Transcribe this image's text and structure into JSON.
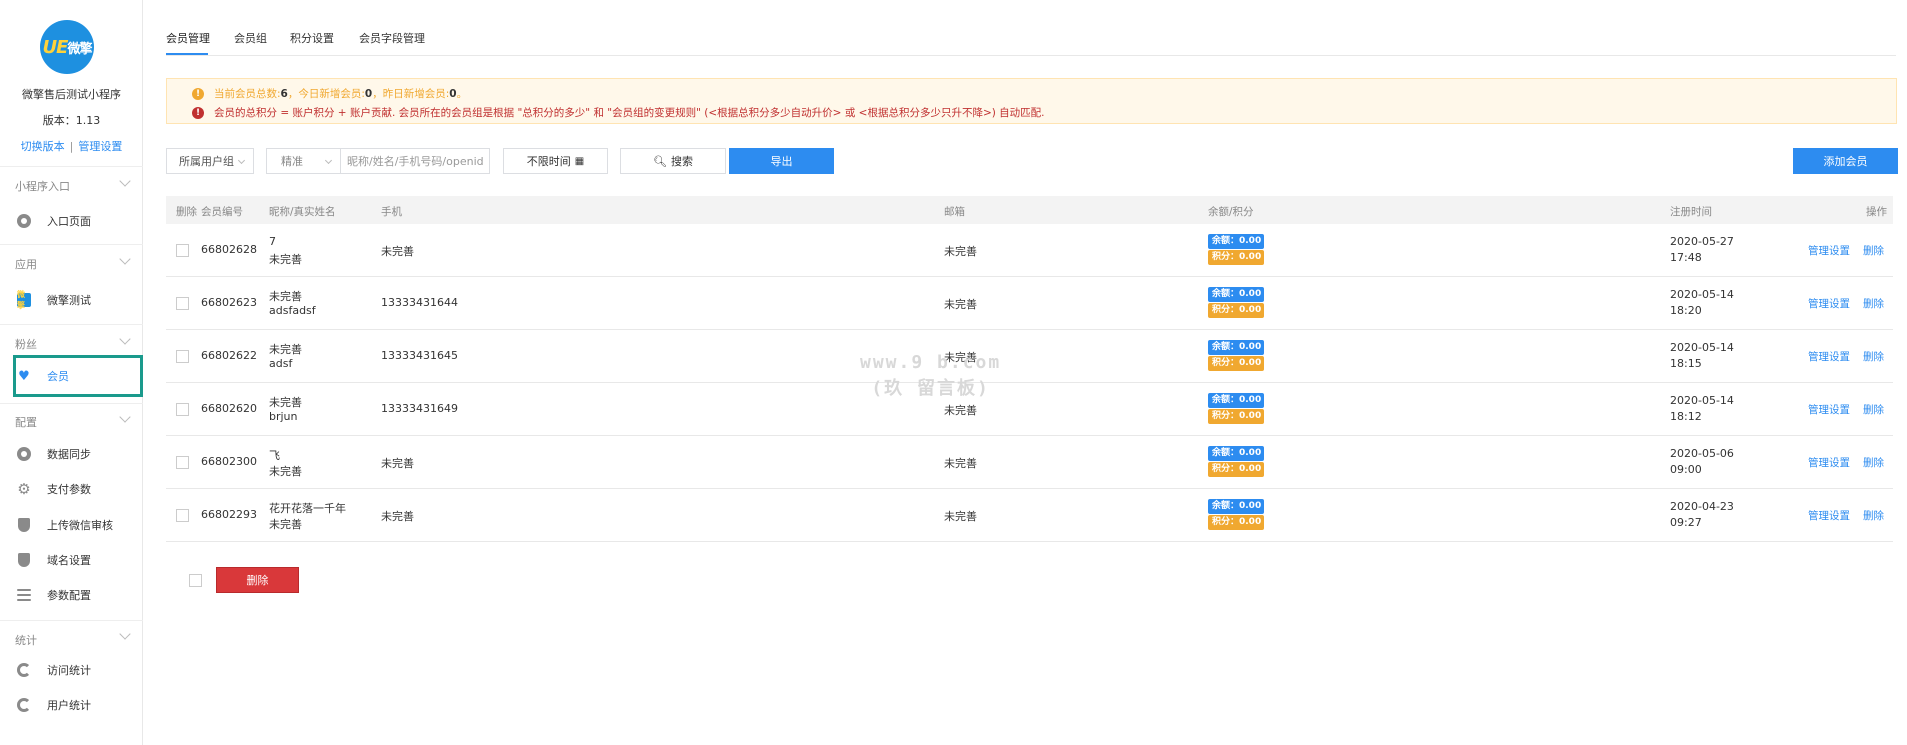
{
  "sidebar": {
    "logo_text_a": "UE",
    "logo_text_b": "微擎",
    "app_name": "微擎售后测试小程序",
    "version": "版本：1.13",
    "switch_version": "切换版本",
    "link_sep": "|",
    "manage_settings": "管理设置",
    "mini_logo": "微擎",
    "sections": [
      {
        "title": "小程序入口",
        "items": [
          {
            "label": "入口页面",
            "icon": "link-icon"
          }
        ]
      },
      {
        "title": "应用",
        "items": [
          {
            "label": "微擎测试",
            "icon": "app-logo-icon"
          }
        ]
      },
      {
        "title": "粉丝",
        "items": [
          {
            "label": "会员",
            "icon": "heart-icon"
          }
        ]
      },
      {
        "title": "配置",
        "items": [
          {
            "label": "数据同步",
            "icon": "link-icon"
          },
          {
            "label": "支付参数",
            "icon": "gear-icon"
          },
          {
            "label": "上传微信审核",
            "icon": "shield-icon"
          },
          {
            "label": "域名设置",
            "icon": "shield-icon"
          },
          {
            "label": "参数配置",
            "icon": "list-icon"
          }
        ]
      },
      {
        "title": "统计",
        "items": [
          {
            "label": "访问统计",
            "icon": "refresh-icon"
          },
          {
            "label": "用户统计",
            "icon": "refresh-icon"
          }
        ]
      }
    ]
  },
  "tabs": [
    "会员管理",
    "会员组",
    "积分设置",
    "会员字段管理"
  ],
  "notice": {
    "line1_a": "当前会员总数:",
    "total": "6",
    "line1_b": "，今日新增会员:",
    "today": "0",
    "line1_c": "，昨日新增会员:",
    "yesterday": "0",
    "line1_d": "。",
    "line2": "会员的总积分 = 账户积分 + 账户贡献. 会员所在的会员组是根据 \"总积分的多少\" 和 \"会员组的变更规则\" (<根据总积分多少自动升价> 或 <根据总积分多少只升不降>) 自动匹配."
  },
  "filters": {
    "user_group": "所属用户组",
    "match": "精准",
    "search_placeholder": "昵称/姓名/手机号码/openid",
    "time": "不限时间",
    "search_btn": "搜索",
    "export_btn": "导出",
    "add_member_btn": "添加会员"
  },
  "table": {
    "headers": {
      "delete": "删除",
      "id": "会员编号",
      "name": "昵称/真实姓名",
      "phone": "手机",
      "email": "邮箱",
      "balance": "余额/积分",
      "reg_time": "注册时间",
      "ops": "操作"
    },
    "balance_label": "余额：0.00",
    "points_label": "积分：0.00",
    "manage_link": "管理设置",
    "delete_link": "删除",
    "rows": [
      {
        "id": "66802628",
        "nick": "7",
        "real": "未完善",
        "phone": "未完善",
        "email": "未完善",
        "date": "2020-05-27",
        "time": "17:48"
      },
      {
        "id": "66802623",
        "nick": "未完善",
        "real": "adsfadsf",
        "phone": "13333431644",
        "email": "未完善",
        "date": "2020-05-14",
        "time": "18:20"
      },
      {
        "id": "66802622",
        "nick": "未完善",
        "real": "adsf",
        "phone": "13333431645",
        "email": "未完善",
        "date": "2020-05-14",
        "time": "18:15"
      },
      {
        "id": "66802620",
        "nick": "未完善",
        "real": "brjun",
        "phone": "13333431649",
        "email": "未完善",
        "date": "2020-05-14",
        "time": "18:12"
      },
      {
        "id": "66802300",
        "nick": "飞",
        "real": "未完善",
        "phone": "未完善",
        "email": "未完善",
        "date": "2020-05-06",
        "time": "09:00"
      },
      {
        "id": "66802293",
        "nick": "花开花落一千年",
        "real": "未完善",
        "phone": "未完善",
        "email": "未完善",
        "date": "2020-04-23",
        "time": "09:27"
      }
    ]
  },
  "bulk_delete": "删除",
  "watermark": {
    "line1": "www.9  b.com",
    "line2": "(玖  留言板)"
  },
  "colors": {
    "primary": "#2d8cf0",
    "danger": "#d9383a",
    "warning": "#f0a830",
    "active_border": "#1a9a8c"
  }
}
